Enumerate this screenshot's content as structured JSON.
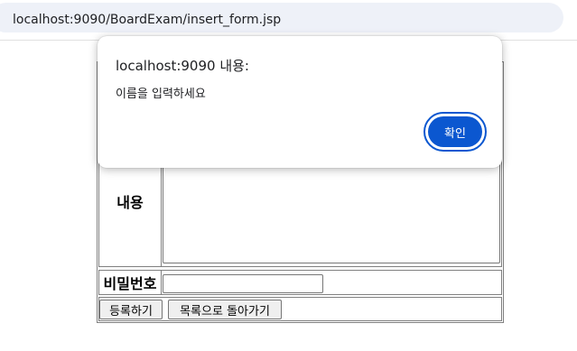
{
  "browser": {
    "url": "localhost:9090/BoardExam/insert_form.jsp"
  },
  "form": {
    "content_label": "내용",
    "password_label": "비밀번호",
    "register_button": "등록하기",
    "back_to_list_button": "목록으로 돌아가기"
  },
  "dialog": {
    "title": "localhost:9090 내용:",
    "message": "이름을 입력하세요",
    "ok_button": "확인",
    "accent_color": "#0b57d0"
  }
}
